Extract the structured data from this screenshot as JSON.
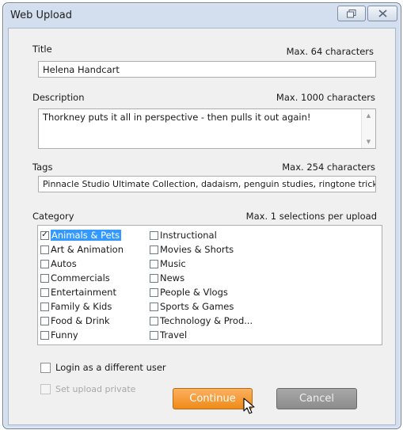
{
  "window": {
    "title": "Web Upload",
    "restore_icon": "restore-icon",
    "close_icon": "close-icon"
  },
  "form": {
    "title_label": "Title",
    "title_limit": "Max. 64 characters",
    "title_value": "Helena Handcart",
    "description_label": "Description",
    "description_limit": "Max. 1000 characters",
    "description_value": "Thorkney puts it all in perspective - then pulls it out again!",
    "tags_label": "Tags",
    "tags_limit": "Max. 254 characters",
    "tags_value": "Pinnacle Studio Ultimate Collection, dadaism, penguin studies, ringtone tricks",
    "category_label": "Category",
    "category_limit": "Max. 1 selections per upload"
  },
  "categories": [
    {
      "label": "Animals & Pets",
      "checked": true
    },
    {
      "label": "Art & Animation",
      "checked": false
    },
    {
      "label": "Autos",
      "checked": false
    },
    {
      "label": "Commercials",
      "checked": false
    },
    {
      "label": "Entertainment",
      "checked": false
    },
    {
      "label": "Family & Kids",
      "checked": false
    },
    {
      "label": "Food & Drink",
      "checked": false
    },
    {
      "label": "Funny",
      "checked": false
    },
    {
      "label": "Instructional",
      "checked": false
    },
    {
      "label": "Movies & Shorts",
      "checked": false
    },
    {
      "label": "Music",
      "checked": false
    },
    {
      "label": "News",
      "checked": false
    },
    {
      "label": "People & Vlogs",
      "checked": false
    },
    {
      "label": "Sports & Games",
      "checked": false
    },
    {
      "label": "Technology & Prod...",
      "checked": false
    },
    {
      "label": "Travel",
      "checked": false
    }
  ],
  "options": {
    "login_label": "Login as a different user",
    "login_checked": false,
    "private_label": "Set upload private",
    "private_checked": false,
    "private_disabled": true
  },
  "buttons": {
    "continue_label": "Continue",
    "cancel_label": "Cancel"
  },
  "colors": {
    "accent_continue": "#f08a18",
    "selection": "#3399ff",
    "window_frame": "#d3dfee"
  }
}
